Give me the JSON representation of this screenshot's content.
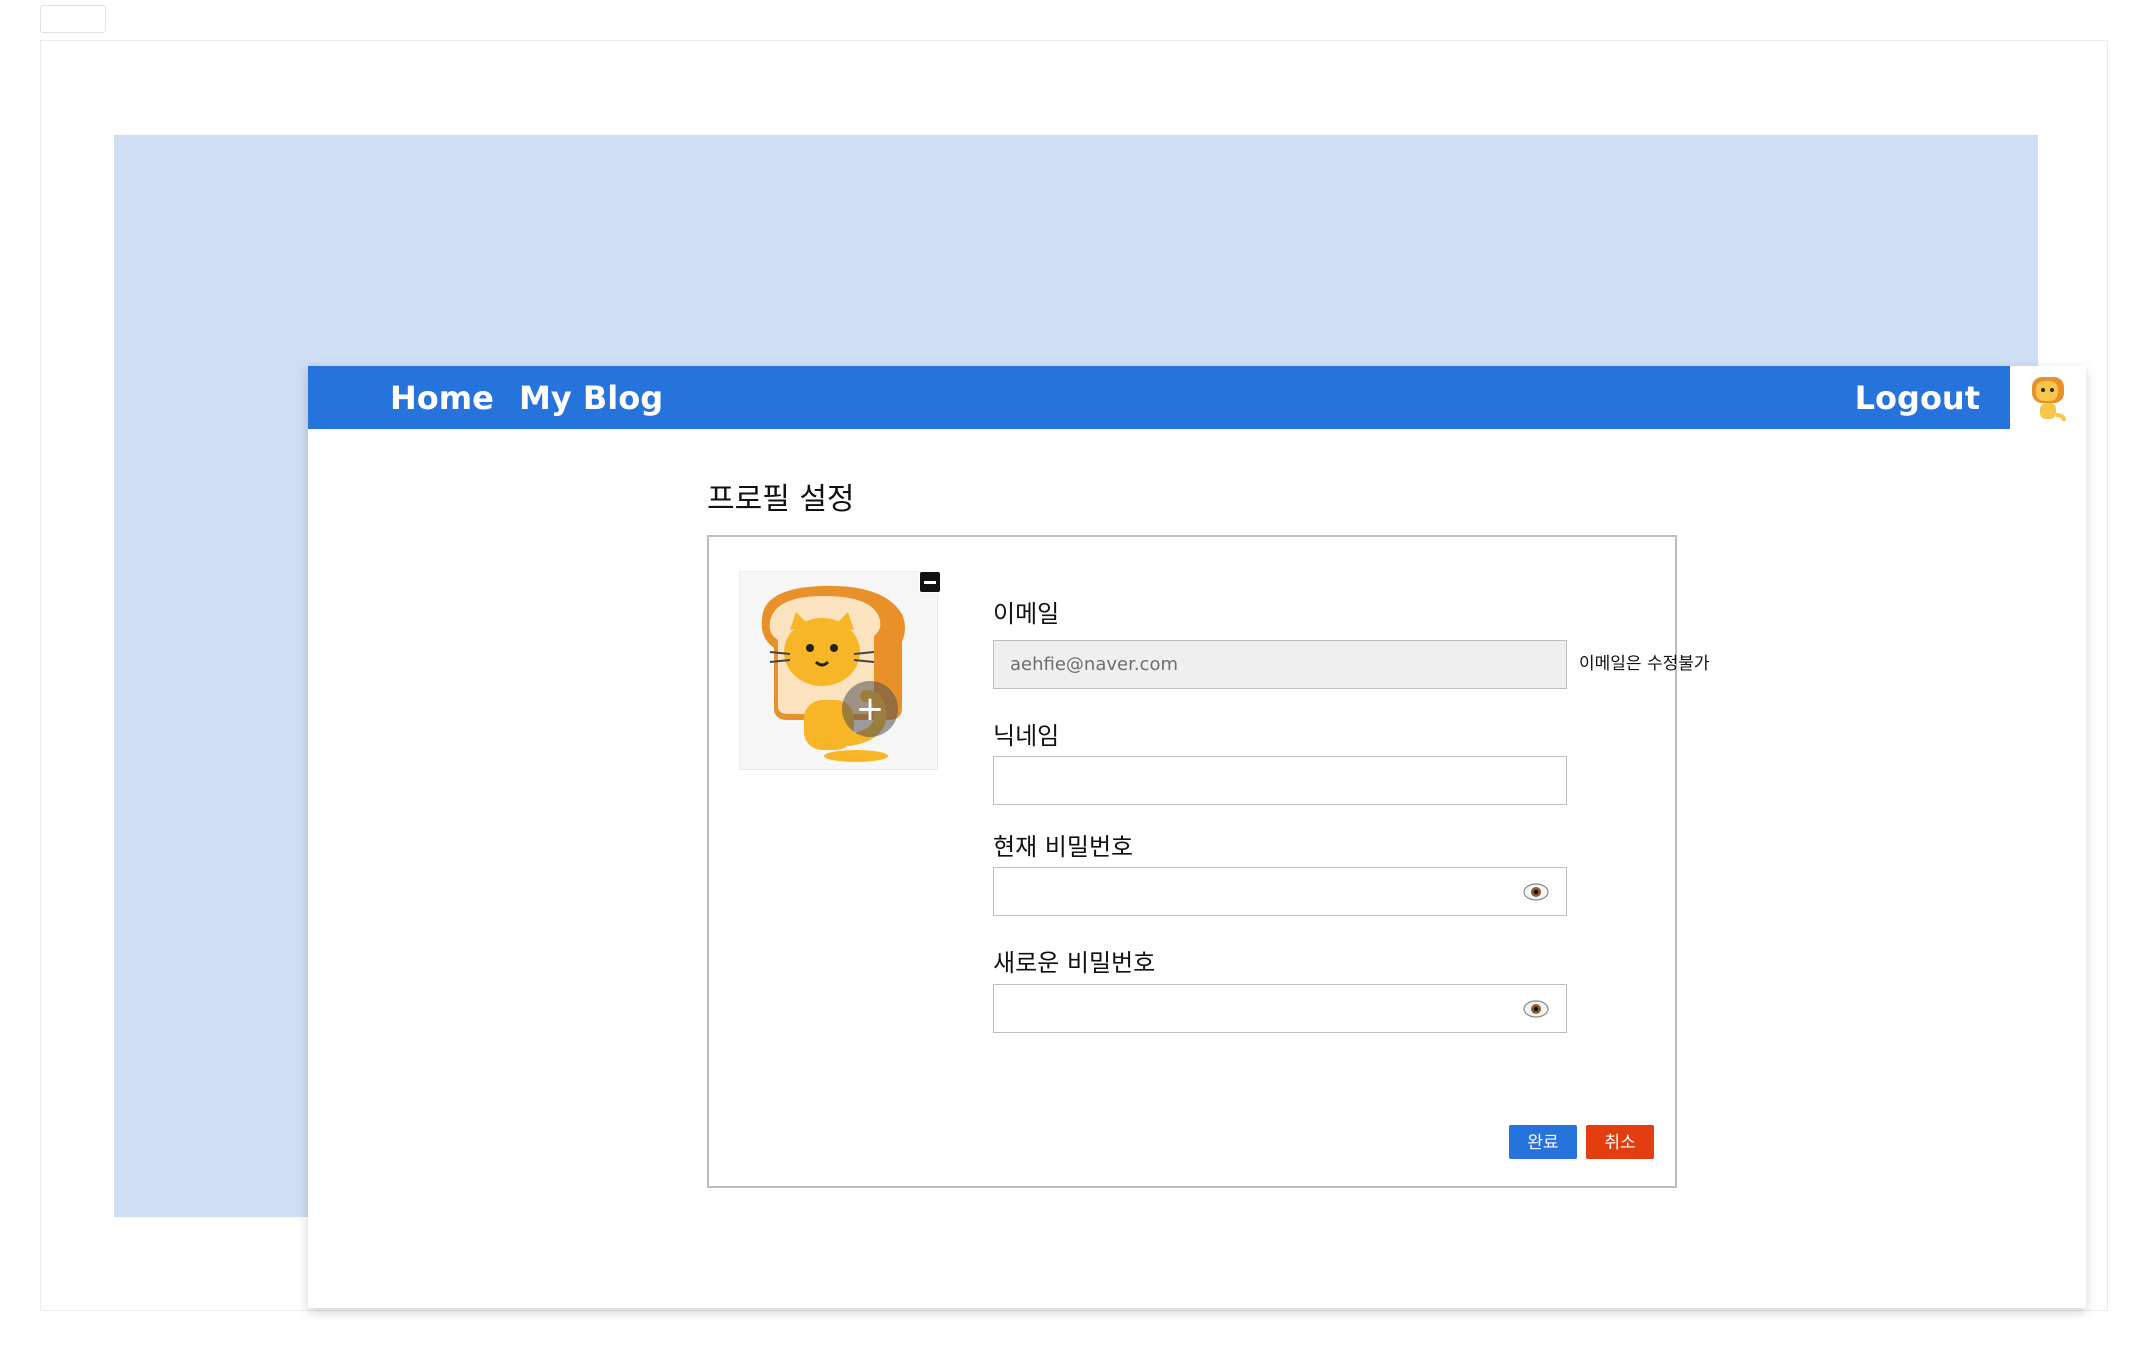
{
  "nav": {
    "home": "Home",
    "my_blog": "My Blog",
    "logout": "Logout"
  },
  "page": {
    "title": "프로필 설정"
  },
  "form": {
    "email": {
      "label": "이메일",
      "value": "aehfie@naver.com",
      "note": "이메일은 수정불가"
    },
    "nickname": {
      "label": "닉네임",
      "value": ""
    },
    "current_password": {
      "label": "현재 비밀번호",
      "value": ""
    },
    "new_password": {
      "label": "새로운 비밀번호",
      "value": ""
    },
    "add_image_symbol": "+",
    "confirm_label": "완료",
    "cancel_label": "취소"
  },
  "colors": {
    "navbar": "#2673dc",
    "background": "#cfddf5",
    "confirm": "#2673dc",
    "cancel": "#e33e10"
  },
  "icons": {
    "avatar": "bread-cat-avatar",
    "eye": "eye-icon",
    "remove": "remove-image-icon"
  }
}
